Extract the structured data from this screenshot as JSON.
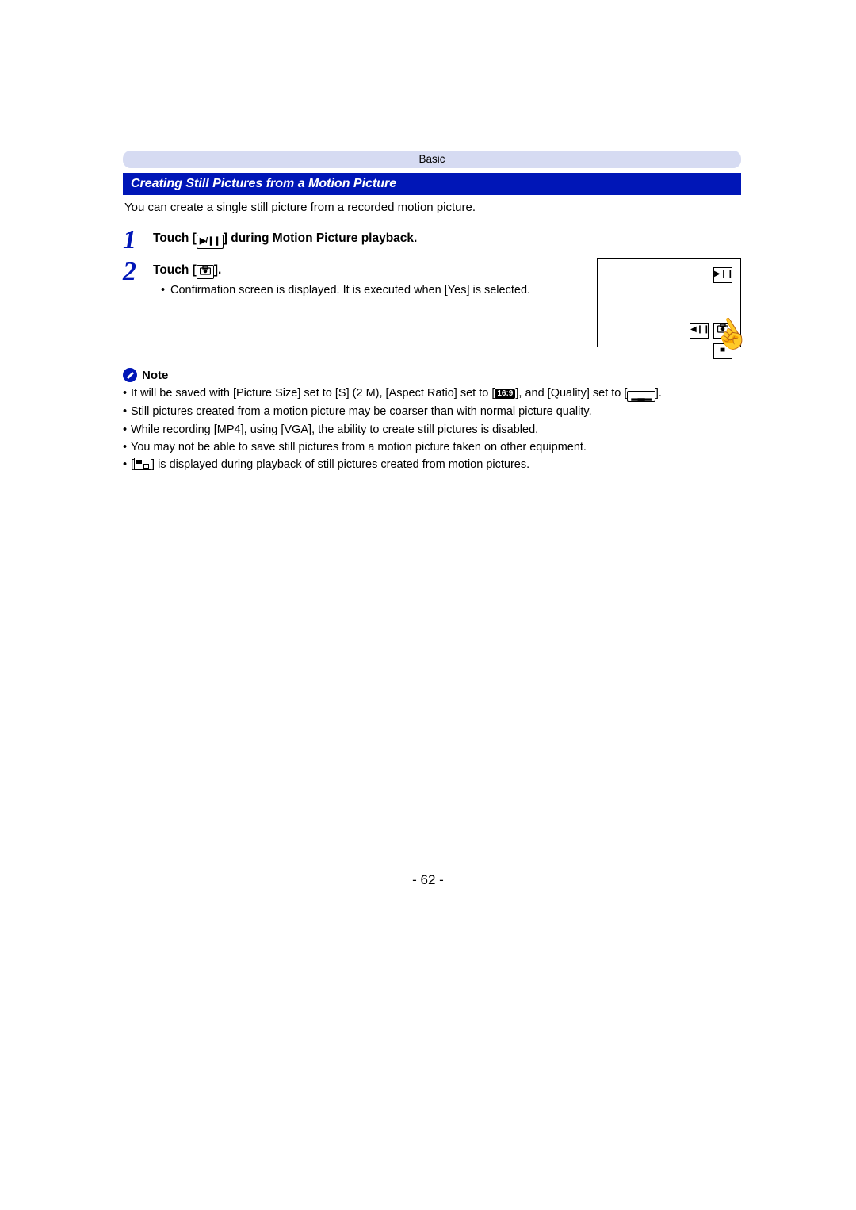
{
  "header_pill": "Basic",
  "section_title": "Creating Still Pictures from a Motion Picture",
  "intro": "You can create a single still picture from a recorded motion picture.",
  "steps": [
    {
      "num": "1",
      "instr_pre": "Touch [",
      "icon_label": "▶/❙❙",
      "instr_post": "] during Motion Picture playback."
    },
    {
      "num": "2",
      "instr_pre": "Touch [",
      "icon_label": "camera",
      "instr_post": "].",
      "sub": "Confirmation screen is displayed. It is executed when [Yes] is selected."
    }
  ],
  "illus_icons": {
    "play_pause": "▶❙❙",
    "rewind": "◀❙❙",
    "camera": "camera",
    "stop": "■"
  },
  "note_label": "Note",
  "notes": {
    "n1_pre": "It will be saved with [Picture Size] set to [S] (2 M), [Aspect Ratio] set to [",
    "n1_badge": "16:9",
    "n1_mid": "], and [Quality] set to [",
    "n1_post": "].",
    "n2": "Still pictures created from a motion picture may be coarser than with normal picture quality.",
    "n3": "While recording [MP4], using [VGA], the ability to create still pictures is disabled.",
    "n4": "You may not be able to save still pictures from a motion picture taken on other equipment.",
    "n5_pre": "[",
    "n5_post": "] is displayed during playback of still pictures created from motion pictures."
  },
  "page_number": "- 62 -"
}
